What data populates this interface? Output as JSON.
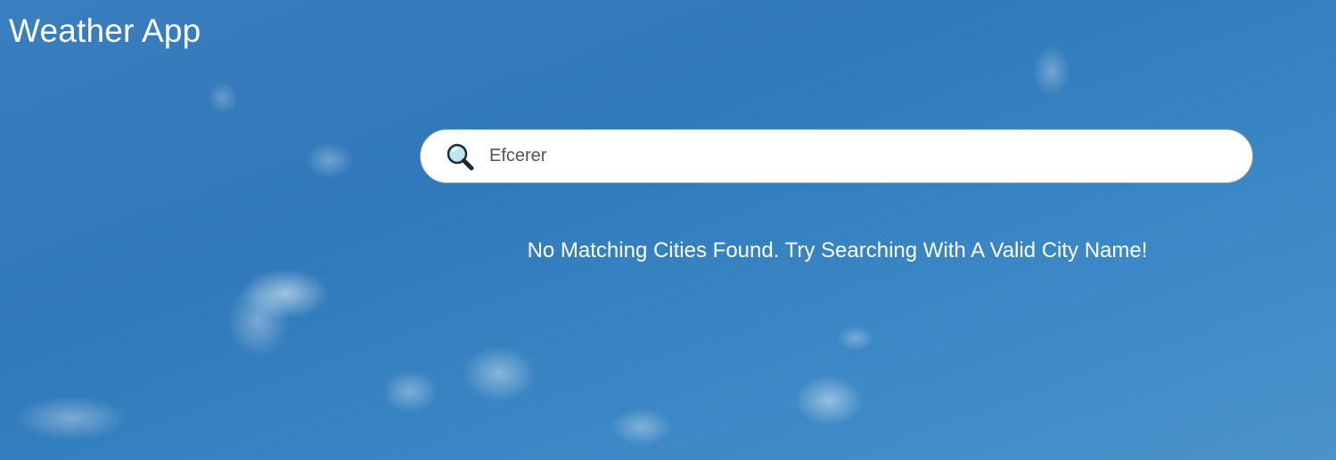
{
  "header": {
    "title": "Weather App"
  },
  "search": {
    "icon": "magnifying-glass-icon",
    "value": "Efcerer"
  },
  "results": {
    "message": "No Matching Cities Found. Try Searching With A Valid City Name!"
  },
  "colors": {
    "sky_blue": "#2f78ba",
    "text": "#ffffff",
    "search_background": "#ffffff"
  }
}
